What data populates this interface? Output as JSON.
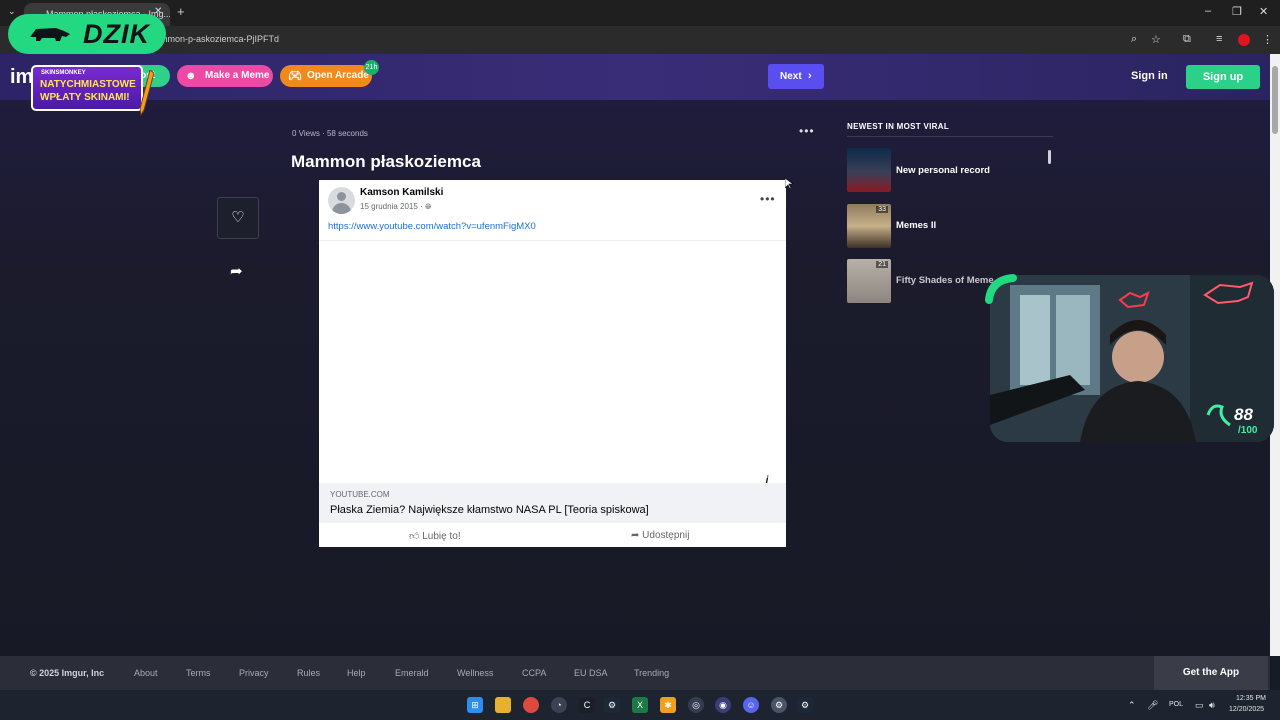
{
  "browser": {
    "tab_title": "Mammon płaskoziemca - Img...",
    "url_fragment": "mmon-p-askoziemca-PjIPFTd",
    "new_tab": "+",
    "tab_close": "✕"
  },
  "overlay": {
    "brand": "DZIK",
    "promo_brand": "SKINSMONKEY",
    "promo_line1": "NATYCHMIASTOWE",
    "promo_line2": "WPŁATY SKINAMI!",
    "cam_score": "88",
    "cam_max": "/100"
  },
  "header": {
    "logo": "im",
    "post_label": "post",
    "meme_label": "Make a Meme",
    "arcade_label": "Open Arcade",
    "arcade_badge": "21h",
    "next_label": "Next",
    "signin_label": "Sign in",
    "signup_label": "Sign up"
  },
  "post": {
    "meta": "0 Views · 58 seconds",
    "title": "Mammon płaskoziemca"
  },
  "fb": {
    "author": "Kamson Kamilski",
    "date": "15 grudnia 2015 · ",
    "link": "https://www.youtube.com/watch?v=ufenmFigMX0",
    "domain": "YOUTUBE.COM",
    "video_title": "Płaska Ziemia? Największe kłamstwo NASA PL [Teoria spiskowa]",
    "like": "Lubię to!",
    "share": "Udostępnij",
    "info_glyph": "i"
  },
  "sidebar": {
    "heading": "NEWEST IN MOST VIRAL",
    "items": [
      {
        "title": "New personal record",
        "count": ""
      },
      {
        "title": "Memes II",
        "count": "33"
      },
      {
        "title": "Fifty Shades of Meme",
        "count": "21"
      }
    ]
  },
  "footer": {
    "copyright": "© 2025 Imgur, Inc",
    "links": [
      "About",
      "Terms",
      "Privacy",
      "Rules",
      "Help",
      "Emerald",
      "Wellness",
      "CCPA",
      "EU DSA",
      "Trending"
    ],
    "get_app": "Get the App"
  },
  "taskbar": {
    "lang": "POL",
    "time": "12:35 PM",
    "date": "12/20/2025"
  },
  "colors": {
    "accent_next": "#5b4ef0",
    "signup": "#2bd188",
    "meme": "#ec4aa4",
    "arcade": "#f08a1c",
    "dzik": "#22d982",
    "fb_link": "#216fdb"
  }
}
